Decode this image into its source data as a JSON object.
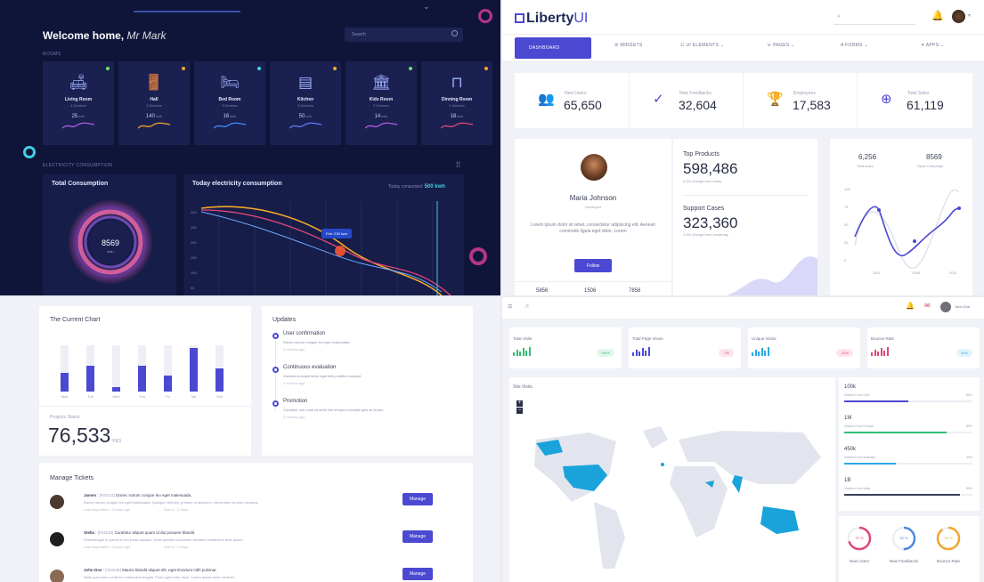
{
  "q1": {
    "welcome_bold": "Welcome home,",
    "welcome_name": "Mr Mark",
    "search_placeholder": "Search",
    "rooms_label": "ROOMS",
    "rooms": [
      {
        "name": "Living Room",
        "devices": "4 Devices",
        "value": "25",
        "unit": "kwh",
        "dot": "#69e36a",
        "icon": "sofa-icon",
        "glyph": "🛋"
      },
      {
        "name": "Hall",
        "devices": "3 Devices",
        "value": "140",
        "unit": "kwh",
        "dot": "#f4a62a",
        "icon": "door-icon",
        "glyph": "🚪"
      },
      {
        "name": "Bed Room",
        "devices": "3 Devices",
        "value": "16",
        "unit": "kwh",
        "dot": "#3fd0e4",
        "icon": "bed-icon",
        "glyph": "🛏"
      },
      {
        "name": "Kitchen",
        "devices": "5 Devices",
        "value": "50",
        "unit": "kwh",
        "dot": "#f4a62a",
        "icon": "fridge-icon",
        "glyph": "▤"
      },
      {
        "name": "Kids Room",
        "devices": "2 Devices",
        "value": "14",
        "unit": "kwh",
        "dot": "#69e36a",
        "icon": "toys-icon",
        "glyph": "🏛"
      },
      {
        "name": "Dinning Room",
        "devices": "4 Devices",
        "value": "18",
        "unit": "kwh",
        "dot": "#f4a62a",
        "icon": "dining-table-icon",
        "glyph": "⊓"
      }
    ],
    "electricity_label": "ELECTRICITY CONSUMPTION",
    "total_title": "Total Consumption",
    "total_value": "8569",
    "total_unit": "kwh",
    "today_title": "Today electricity consumption",
    "today_label": "Today consumed:",
    "today_value": "500 kwh",
    "tooltip": "Feb: 230 kwh",
    "y_ticks": [
      "300",
      "250",
      "200",
      "150",
      "100",
      "50"
    ]
  },
  "q2": {
    "logo_main": "Liberty",
    "logo_ui": "UI",
    "nav": [
      "DASHBOARD",
      "WIDGETS",
      "UI ELEMENTS",
      "PAGES",
      "FORMS",
      "APPS"
    ],
    "nav_icons": [
      "dashboard-icon",
      "widgets-icon",
      "ui-elements-icon",
      "pages-icon",
      "forms-icon",
      "apps-icon"
    ],
    "stats": [
      {
        "label": "New Users",
        "value": "65,650",
        "icon": "users-icon",
        "glyph": "👥"
      },
      {
        "label": "New Feedbacks",
        "value": "32,604",
        "icon": "check-circle-icon",
        "glyph": "✓"
      },
      {
        "label": "Employees",
        "value": "17,583",
        "icon": "trophy-icon",
        "glyph": "🏆"
      },
      {
        "label": "Total Sales",
        "value": "61,119",
        "icon": "target-icon",
        "glyph": "⊕"
      }
    ],
    "profile": {
      "name": "Maria Johnson",
      "role": "Developer",
      "bio": "Lorem ipsum dolor sit amet, consectetur adipiscing elit. Aenean commodo ligula eget dolor. Lorem",
      "follow": "Follow",
      "counts": [
        "5856",
        "1506",
        "7856"
      ]
    },
    "products": {
      "title": "Top Products",
      "value": "598,486",
      "sub": "6.5% change from today",
      "support_title": "Support Cases",
      "support_value": "323,360",
      "support_sub": "2.6% change from yesterday"
    },
    "mini_chart": {
      "total_sales": "6,256",
      "total_sales_label": "Total sales",
      "open_campaign": "8569",
      "open_campaign_label": "Open Campaign",
      "y_ticks": [
        "100",
        "75",
        "50",
        "25",
        "0"
      ],
      "x_ticks": [
        "2007",
        "2008",
        "2011"
      ]
    }
  },
  "q3": {
    "current_chart_title": "The Current Chart",
    "days": [
      "Mon",
      "Tue",
      "Wed",
      "Thu",
      "Fri",
      "Sat",
      "Sun"
    ],
    "bars": [
      40,
      55,
      10,
      55,
      35,
      95,
      50
    ],
    "projects_label": "Projects Status",
    "projects_value": "76,533",
    "projects_unit": "PES",
    "updates_title": "Updates",
    "updates": [
      {
        "title": "User confirmation",
        "text": "Donec rutrum congue leo eget malesuada.",
        "time": "2 months ago"
      },
      {
        "title": "Continuous evaluation",
        "text": "Vivamus suscipit tortor eget felis porttitor volutpat.",
        "time": "2 months ago"
      },
      {
        "title": "Promotion",
        "text": "Curabitur non nulla sit amet nisl tempus convallis quis ac lectus.",
        "time": "2 months ago"
      }
    ],
    "tickets_title": "Manage Tickets",
    "tickets": [
      {
        "name": "James",
        "code": "[#23211]",
        "subject": "Donec rutrum congue leo eget malesuada.",
        "detail": "Donec rutrum congue leo eget malesuada. Quisque velit nisi, pretium ut lacinia in, elementum id enim vivamus.",
        "last": "Last responded : 3 hours ago",
        "due": "Due in : 2 Days",
        "btn": "Manage"
      },
      {
        "name": "Stella",
        "code": "[#23135]",
        "subject": "Curabitur aliquet quam id dui posuere blandit.",
        "detail": "Pellentesque in ipsum id orci porta dapibus. Nulla porttitor accumsan tincidunt vestibulum ante ipsum.",
        "last": "Last responded : 3 hours ago",
        "due": "Due in : 2 Days",
        "btn": "Manage"
      },
      {
        "name": "John Doe",
        "code": "[#23246]",
        "subject": "Mauris blandit aliquet elit, eget tincidunt nibh pulvinar.",
        "detail": "Nulla quis lorem ut libero malesuada feugiat. Proin eget tortor risus. Lorem ipsum dolor sit amet.",
        "last": "",
        "due": "",
        "btn": "Manage"
      }
    ]
  },
  "q4": {
    "user_name": "John Doe",
    "kpis": [
      {
        "label": "Total Visits",
        "badge": "+60%",
        "badge_color": "#2fbf71",
        "badge_bg": "#e2f7ec",
        "spark": "#2fbf71"
      },
      {
        "label": "Total Page Views",
        "badge": "-7%",
        "badge_color": "#e0457b",
        "badge_bg": "#fde4ee",
        "spark": "#4b49d1"
      },
      {
        "label": "Unique Visitor",
        "badge": "-32%",
        "badge_color": "#e0457b",
        "badge_bg": "#fde4ee",
        "spark": "#2aa9e0"
      },
      {
        "label": "Bounce Rate",
        "badge": "33%",
        "badge_color": "#2aa9e0",
        "badge_bg": "#e2f3fc",
        "spark": "#e0457b"
      }
    ],
    "map_title": "Site Visits",
    "regions": [
      {
        "value": "100k",
        "label": "Visitors From USA",
        "pct": "50%",
        "fill": 50,
        "color": "#4b49d1"
      },
      {
        "value": "1M",
        "label": "Visitors From Europe",
        "pct": "80%",
        "fill": 80,
        "color": "#2fbf71"
      },
      {
        "value": "450k",
        "label": "Visitors From Australia",
        "pct": "40%",
        "fill": 40,
        "color": "#2aa9e0"
      },
      {
        "value": "1B",
        "label": "Visitors From India",
        "pct": "90%",
        "fill": 90,
        "color": "#3a3f58"
      }
    ],
    "donuts": [
      {
        "label": "New Users",
        "pct": "70 %",
        "fill": 0.7,
        "color": "#e0457b"
      },
      {
        "label": "New Feedbacks",
        "pct": "50 %",
        "fill": 0.5,
        "color": "#4b8ae0"
      },
      {
        "label": "Bounce Rate",
        "pct": "90 %",
        "fill": 0.9,
        "color": "#f4a62a"
      }
    ]
  }
}
